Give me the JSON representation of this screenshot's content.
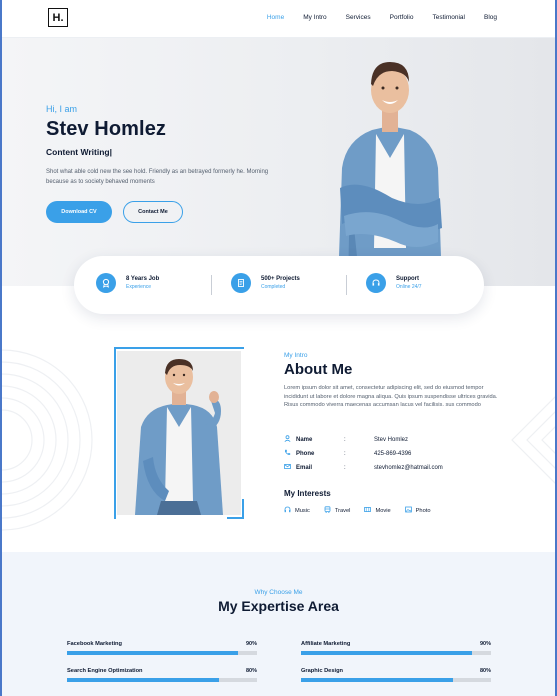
{
  "header": {
    "logo": "H.",
    "nav": [
      {
        "label": "Home",
        "active": true
      },
      {
        "label": "My Intro",
        "active": false
      },
      {
        "label": "Services",
        "active": false
      },
      {
        "label": "Portfolio",
        "active": false
      },
      {
        "label": "Testimonial",
        "active": false
      },
      {
        "label": "Blog",
        "active": false
      }
    ]
  },
  "hero": {
    "greeting": "Hi, I am",
    "name": "Stev Homlez",
    "role": "Content Writing|",
    "description": "Shot what able cold new the see hold. Friendly as an betrayed formerly he. Morning because as to society behaved moments",
    "primary_button": "Download CV",
    "secondary_button": "Contact Me"
  },
  "stats": [
    {
      "title": "8 Years Job",
      "subtitle": "Experience",
      "icon": "award-icon"
    },
    {
      "title": "500+ Projects",
      "subtitle": "Completed",
      "icon": "document-icon"
    },
    {
      "title": "Support",
      "subtitle": "Online 24/7",
      "icon": "headset-icon"
    }
  ],
  "about": {
    "kicker": "My Intro",
    "title": "About Me",
    "description": "Lorem ipsum dolor sit amet, consectetur adipiscing elit, sed do eiusmod tempor incididunt ut labore et dolore magna aliqua. Quis ipsum suspendisse ultrices gravida. Risus commodo viverra maecenas accumsan lacus vel facilisis. sus commodo",
    "separator": ":",
    "info": [
      {
        "label": "Name",
        "value": "Stev Homlez",
        "icon": "user-icon"
      },
      {
        "label": "Phone",
        "value": "425-869-4396",
        "icon": "phone-icon"
      },
      {
        "label": "Email",
        "value": "stevhomlez@hatmail.com",
        "icon": "mail-icon"
      }
    ],
    "interests_title": "My Interests",
    "interests": [
      {
        "label": "Music",
        "icon": "headphones-icon"
      },
      {
        "label": "Travel",
        "icon": "bus-icon"
      },
      {
        "label": "Movie",
        "icon": "film-icon"
      },
      {
        "label": "Photo",
        "icon": "image-icon"
      }
    ]
  },
  "expertise": {
    "kicker": "Why Choose Me",
    "title": "My Expertise Area",
    "skills": [
      {
        "label": "Facebook Marketing",
        "percent_text": "90%",
        "value": 90
      },
      {
        "label": "Affiliate Marketing",
        "percent_text": "90%",
        "value": 90
      },
      {
        "label": "Search Engine Optimization",
        "percent_text": "80%",
        "value": 80
      },
      {
        "label": "Graphic Design",
        "percent_text": "80%",
        "value": 80
      }
    ]
  },
  "colors": {
    "accent": "#3aa0e8",
    "heading": "#0f1b33",
    "hero_bg": "#eceef1",
    "expertise_bg": "#f1f5fb"
  }
}
